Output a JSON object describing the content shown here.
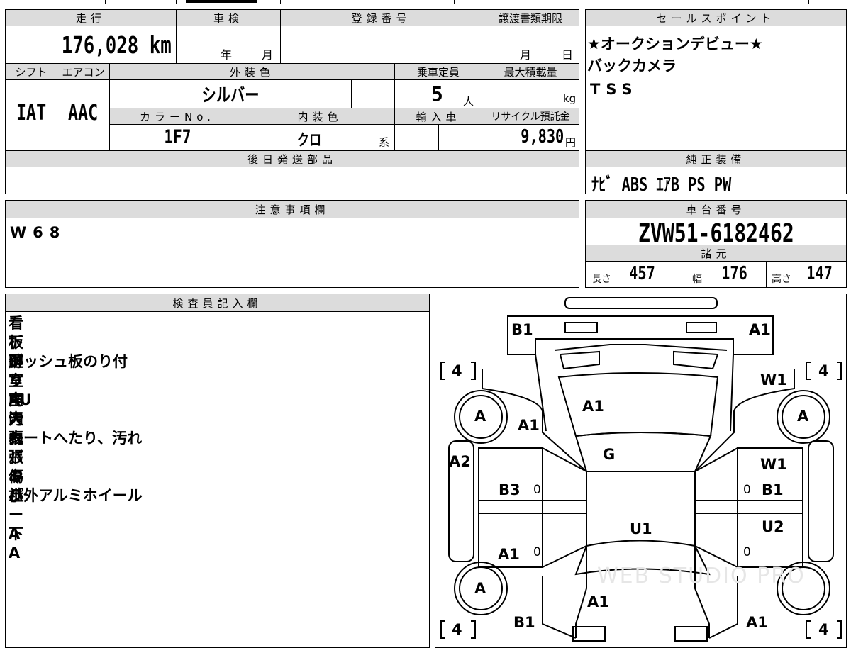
{
  "mileage": {
    "label": "走行",
    "value": "176,028",
    "unit": "km"
  },
  "inspection": {
    "label": "車検",
    "year_unit": "年",
    "month_unit": "月"
  },
  "registration": {
    "label": "登録番号"
  },
  "transfer_deadline": {
    "label": "譲渡書類期限",
    "month_unit": "月",
    "day_unit": "日"
  },
  "shift": {
    "label": "シフト",
    "value": "IAT"
  },
  "aircon": {
    "label": "エアコン",
    "value": "AAC"
  },
  "exterior_color": {
    "label": "外装色",
    "value": "シルバー"
  },
  "capacity": {
    "label": "乗車定員",
    "value": "5",
    "unit": "人"
  },
  "max_load": {
    "label": "最大積載量",
    "unit": "kg"
  },
  "color_no": {
    "label": "カラーNo.",
    "value": "1F7"
  },
  "interior_color": {
    "label": "内装色",
    "value": "クロ",
    "suffix": "系"
  },
  "import": {
    "label": "輸入車"
  },
  "recycle": {
    "label": "リサイクル預託金",
    "value": "9,830",
    "unit": "円"
  },
  "later_parts": {
    "label": "後日発送部品"
  },
  "sales_points": {
    "label": "セールスポイント",
    "lines": [
      "★オークションデビュー★",
      "バックカメラ",
      "TSS"
    ]
  },
  "genuine_equipment": {
    "label": "純正装備",
    "value": "ﾅﾋﾞ ABS ｴｱB PS PW"
  },
  "notes": {
    "label": "注意事項欄",
    "value": "W68"
  },
  "chassis_no": {
    "label": "車台番号",
    "value": "ZVW51-6182462"
  },
  "specs": {
    "label": "諸元",
    "length_label": "長さ",
    "length": "457",
    "width_label": "幅",
    "width": "176",
    "height_label": "高さ",
    "height": "147"
  },
  "inspector": {
    "label": "検査員記入欄",
    "lines": [
      "看板跡",
      "下廻りAU",
      "ダッシュ板のり付",
      "室内汚れ",
      "室内内張傷",
      "天張しみ小",
      "シートへたり、汚れ",
      "バンパー下A",
      "ミラーA",
      "社外アルミホイール"
    ]
  },
  "diagram": {
    "marks": {
      "rear_left": "B1",
      "rear_right": "A1",
      "tire_tl": "4",
      "tire_tr": "4",
      "tire_bl": "4",
      "tire_br": "4",
      "wheel_tl": "A",
      "wheel_tr": "A",
      "wheel_bl": "A",
      "quarter_left": "A1",
      "rear_glass": "A1",
      "right_w1_top": "W1",
      "roof_g": "G",
      "left_a2": "A2",
      "right_w1": "W1",
      "left_b3": "B3",
      "right_b1": "B1",
      "center_u1": "U1",
      "right_u2": "U2",
      "left_a1": "A1",
      "hood_a1": "A1",
      "front_left_b1": "B1",
      "front_right_a1": "A1",
      "zero": "0"
    },
    "watermark": "WEB STUDIO PRO"
  }
}
